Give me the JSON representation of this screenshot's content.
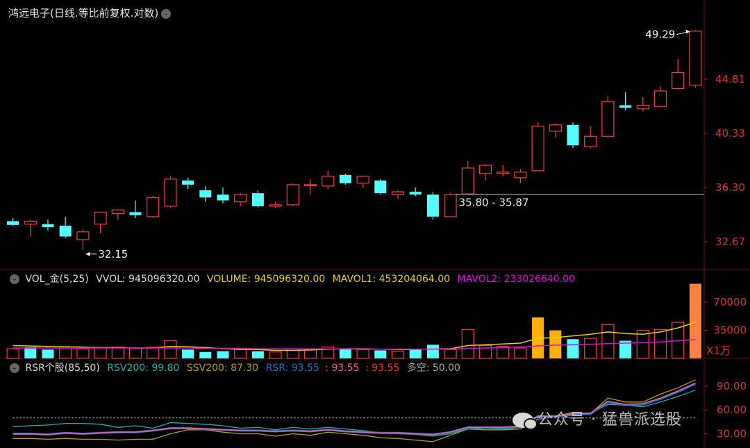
{
  "header": {
    "title": "鸿远电子(日线.等比前复权.对数)"
  },
  "volume_header": {
    "name": "VOL_金(5,25)",
    "vvol": "VVOL: 945096320.00",
    "volume": "VOLUME: 945096320.00",
    "mavol1": "MAVOL1: 453204064.00",
    "mavol2": "MAVOL2: 233026640.00",
    "unit": "X1万"
  },
  "rsr_header": {
    "name": "RSR个股(85,50)",
    "rsv200": "RSV200: 99.80",
    "ssv200": "SSV200: 87.30",
    "rsr": "RSR: 93.55",
    "v1": ": 93.55",
    "v2": ": 93.55",
    "duokong": "多空: 50.00"
  },
  "watermark": "公众号 · 猛兽派选股",
  "colors": {
    "up": "#ff3b3b",
    "down": "#54ffff",
    "vol_gold": "#ffb000",
    "vol_orange": "#ff8040",
    "ma1": "#e8d200",
    "ma2": "#e600e6",
    "rsv": "#20b2aa",
    "ssv": "#b8a000",
    "rsr": "#2070d0",
    "pink": "#ff6090",
    "axis_text": "#e03030"
  },
  "chart_data": [
    {
      "type": "candlestick",
      "title": "鸿远电子(日线.等比前复权.对数)",
      "log_scale": true,
      "y_ticks": [
        32.67,
        36.3,
        40.33,
        44.81
      ],
      "ylim": [
        31.2,
        50.2
      ],
      "annotations": {
        "high_label": "49.29",
        "low_label": "32.15",
        "range_label": "35.80 - 35.87",
        "range_value": 35.83
      },
      "candles": [
        {
          "o": 34.0,
          "h": 34.2,
          "l": 33.7,
          "c": 33.75
        },
        {
          "o": 33.8,
          "h": 34.1,
          "l": 33.0,
          "c": 34.0
        },
        {
          "o": 33.8,
          "h": 34.1,
          "l": 33.4,
          "c": 33.6
        },
        {
          "o": 33.7,
          "h": 34.3,
          "l": 32.9,
          "c": 33.0
        },
        {
          "o": 32.8,
          "h": 33.5,
          "l": 32.15,
          "c": 33.3
        },
        {
          "o": 33.8,
          "h": 34.6,
          "l": 33.2,
          "c": 34.6
        },
        {
          "o": 34.5,
          "h": 34.8,
          "l": 34.1,
          "c": 34.75
        },
        {
          "o": 34.6,
          "h": 35.4,
          "l": 34.2,
          "c": 34.4
        },
        {
          "o": 34.3,
          "h": 35.7,
          "l": 34.2,
          "c": 35.6
        },
        {
          "o": 35.0,
          "h": 37.1,
          "l": 34.9,
          "c": 36.9
        },
        {
          "o": 36.8,
          "h": 37.0,
          "l": 36.2,
          "c": 36.5
        },
        {
          "o": 36.1,
          "h": 36.4,
          "l": 35.3,
          "c": 35.6
        },
        {
          "o": 35.8,
          "h": 36.3,
          "l": 35.2,
          "c": 35.4
        },
        {
          "o": 35.3,
          "h": 35.9,
          "l": 35.0,
          "c": 35.8
        },
        {
          "o": 35.9,
          "h": 36.1,
          "l": 34.9,
          "c": 35.0
        },
        {
          "o": 35.0,
          "h": 35.3,
          "l": 34.9,
          "c": 35.1
        },
        {
          "o": 35.1,
          "h": 36.6,
          "l": 35.0,
          "c": 36.5
        },
        {
          "o": 36.5,
          "h": 36.9,
          "l": 35.8,
          "c": 36.5
        },
        {
          "o": 36.4,
          "h": 37.5,
          "l": 36.2,
          "c": 37.1
        },
        {
          "o": 37.2,
          "h": 37.3,
          "l": 36.5,
          "c": 36.6
        },
        {
          "o": 36.6,
          "h": 37.0,
          "l": 36.3,
          "c": 37.1
        },
        {
          "o": 36.8,
          "h": 36.9,
          "l": 35.8,
          "c": 35.9
        },
        {
          "o": 35.8,
          "h": 36.1,
          "l": 35.5,
          "c": 36.0
        },
        {
          "o": 36.0,
          "h": 36.3,
          "l": 35.7,
          "c": 35.8
        },
        {
          "o": 35.8,
          "h": 36.0,
          "l": 34.1,
          "c": 34.3
        },
        {
          "o": 34.3,
          "h": 35.9,
          "l": 34.3,
          "c": 35.8
        },
        {
          "o": 35.85,
          "h": 38.2,
          "l": 35.8,
          "c": 37.7
        },
        {
          "o": 37.3,
          "h": 38.0,
          "l": 36.8,
          "c": 37.9
        },
        {
          "o": 37.3,
          "h": 37.9,
          "l": 37.1,
          "c": 37.4
        },
        {
          "o": 37.0,
          "h": 37.6,
          "l": 36.6,
          "c": 37.4
        },
        {
          "o": 37.5,
          "h": 41.2,
          "l": 37.5,
          "c": 40.9
        },
        {
          "o": 40.5,
          "h": 41.1,
          "l": 40.0,
          "c": 41.0
        },
        {
          "o": 41.0,
          "h": 41.2,
          "l": 39.2,
          "c": 39.4
        },
        {
          "o": 39.3,
          "h": 40.9,
          "l": 39.2,
          "c": 40.1
        },
        {
          "o": 40.1,
          "h": 43.4,
          "l": 40.0,
          "c": 42.9
        },
        {
          "o": 42.6,
          "h": 43.7,
          "l": 42.2,
          "c": 42.4
        },
        {
          "o": 42.3,
          "h": 43.3,
          "l": 42.1,
          "c": 42.6
        },
        {
          "o": 42.5,
          "h": 44.2,
          "l": 42.4,
          "c": 43.8
        },
        {
          "o": 44.0,
          "h": 46.6,
          "l": 43.9,
          "c": 45.4
        },
        {
          "o": 44.3,
          "h": 49.29,
          "l": 44.1,
          "c": 49.2
        }
      ]
    },
    {
      "type": "bar",
      "title": "VOL_金(5,25)",
      "unit": "X1万",
      "y_ticks": [
        35000,
        70000
      ],
      "ylim": [
        0,
        90000
      ],
      "values": [
        12000,
        14000,
        11000,
        13000,
        12000,
        13000,
        14000,
        13000,
        14000,
        22000,
        11000,
        8000,
        9000,
        11000,
        9000,
        8000,
        12000,
        11000,
        14000,
        12000,
        11000,
        10000,
        9000,
        11000,
        17000,
        11000,
        36000,
        16000,
        15000,
        13000,
        51000,
        35000,
        24000,
        25000,
        42000,
        22000,
        35000,
        36000,
        45000,
        93000
      ],
      "bar_colors": [
        "up",
        "down",
        "down",
        "up",
        "up",
        "up",
        "up",
        "up",
        "up",
        "up",
        "down",
        "down",
        "down",
        "up",
        "down",
        "up",
        "up",
        "up",
        "up",
        "down",
        "up",
        "down",
        "up",
        "down",
        "down",
        "up",
        "up",
        "up",
        "up",
        "up",
        "gold",
        "gold",
        "down",
        "up",
        "up",
        "down",
        "up",
        "up",
        "up",
        "orange"
      ],
      "series": [
        {
          "name": "MAVOL1",
          "values": [
            16000,
            15500,
            15000,
            14500,
            14000,
            13500,
            13500,
            13000,
            13000,
            15000,
            14500,
            13500,
            12000,
            11500,
            11000,
            10000,
            10000,
            10500,
            11500,
            12000,
            12000,
            11500,
            11000,
            11000,
            12000,
            12000,
            16000,
            17000,
            18000,
            19000,
            25000,
            26000,
            28000,
            30000,
            33000,
            31000,
            30000,
            33000,
            38000,
            45000
          ]
        },
        {
          "name": "MAVOL2",
          "values": [
            13000,
            13000,
            13000,
            13000,
            13000,
            13000,
            13000,
            13000,
            13000,
            13000,
            13000,
            12500,
            12500,
            12500,
            12000,
            12000,
            12000,
            11800,
            11800,
            11800,
            11800,
            11500,
            11500,
            11500,
            11600,
            11700,
            12500,
            13000,
            13500,
            14000,
            15500,
            16500,
            17000,
            17500,
            18500,
            19000,
            19500,
            20500,
            22000,
            23500
          ]
        }
      ]
    },
    {
      "type": "line",
      "title": "RSR个股(85,50)",
      "y_ticks": [
        30.0,
        60.0,
        90.0
      ],
      "ylim": [
        12,
        104
      ],
      "series": [
        {
          "name": "RSV200",
          "values": [
            24,
            24,
            23,
            24,
            23,
            23,
            22,
            23,
            23,
            30,
            35,
            35,
            32,
            30,
            30,
            27,
            30,
            28,
            32,
            30,
            28,
            25,
            24,
            22,
            20,
            28,
            36,
            35,
            35,
            36,
            52,
            52,
            57,
            55,
            75,
            70,
            70,
            80,
            88,
            98
          ]
        },
        {
          "name": "SSV200",
          "values": [
            39,
            40,
            41,
            43,
            43,
            42,
            38,
            40,
            37,
            44,
            43,
            42,
            40,
            37,
            38,
            35,
            38,
            36,
            38,
            36,
            34,
            31,
            30,
            29,
            27,
            30,
            36,
            37,
            36,
            38,
            48,
            52,
            56,
            56,
            67,
            66,
            64,
            70,
            77,
            85
          ]
        },
        {
          "name": "RSR",
          "values": [
            30,
            30,
            29,
            31,
            30,
            31,
            32,
            32,
            34,
            37,
            37,
            36,
            35,
            34,
            34,
            33,
            34,
            33,
            35,
            33,
            32,
            31,
            31,
            30,
            29,
            32,
            38,
            38,
            38,
            39,
            52,
            52,
            54,
            55,
            70,
            66,
            67,
            74,
            83,
            93
          ]
        },
        {
          "name": "",
          "values": [
            30,
            30,
            29,
            31,
            30,
            31,
            32,
            32,
            34,
            37,
            37,
            36,
            35,
            34,
            34,
            33,
            34,
            33,
            35,
            33,
            32,
            31,
            31,
            30,
            29,
            32,
            38,
            38,
            38,
            39,
            52,
            52,
            55,
            56,
            71,
            67,
            68,
            75,
            84,
            94
          ]
        },
        {
          "name": "多空",
          "values": [
            50,
            50,
            50,
            50,
            50,
            50,
            50,
            50,
            50,
            50,
            50,
            50,
            50,
            50,
            50,
            50,
            50,
            50,
            50,
            50,
            50,
            50,
            50,
            50,
            50,
            50,
            50,
            50,
            50,
            50,
            50,
            50,
            50,
            50,
            50,
            50,
            50,
            50,
            50,
            50
          ]
        }
      ]
    }
  ]
}
